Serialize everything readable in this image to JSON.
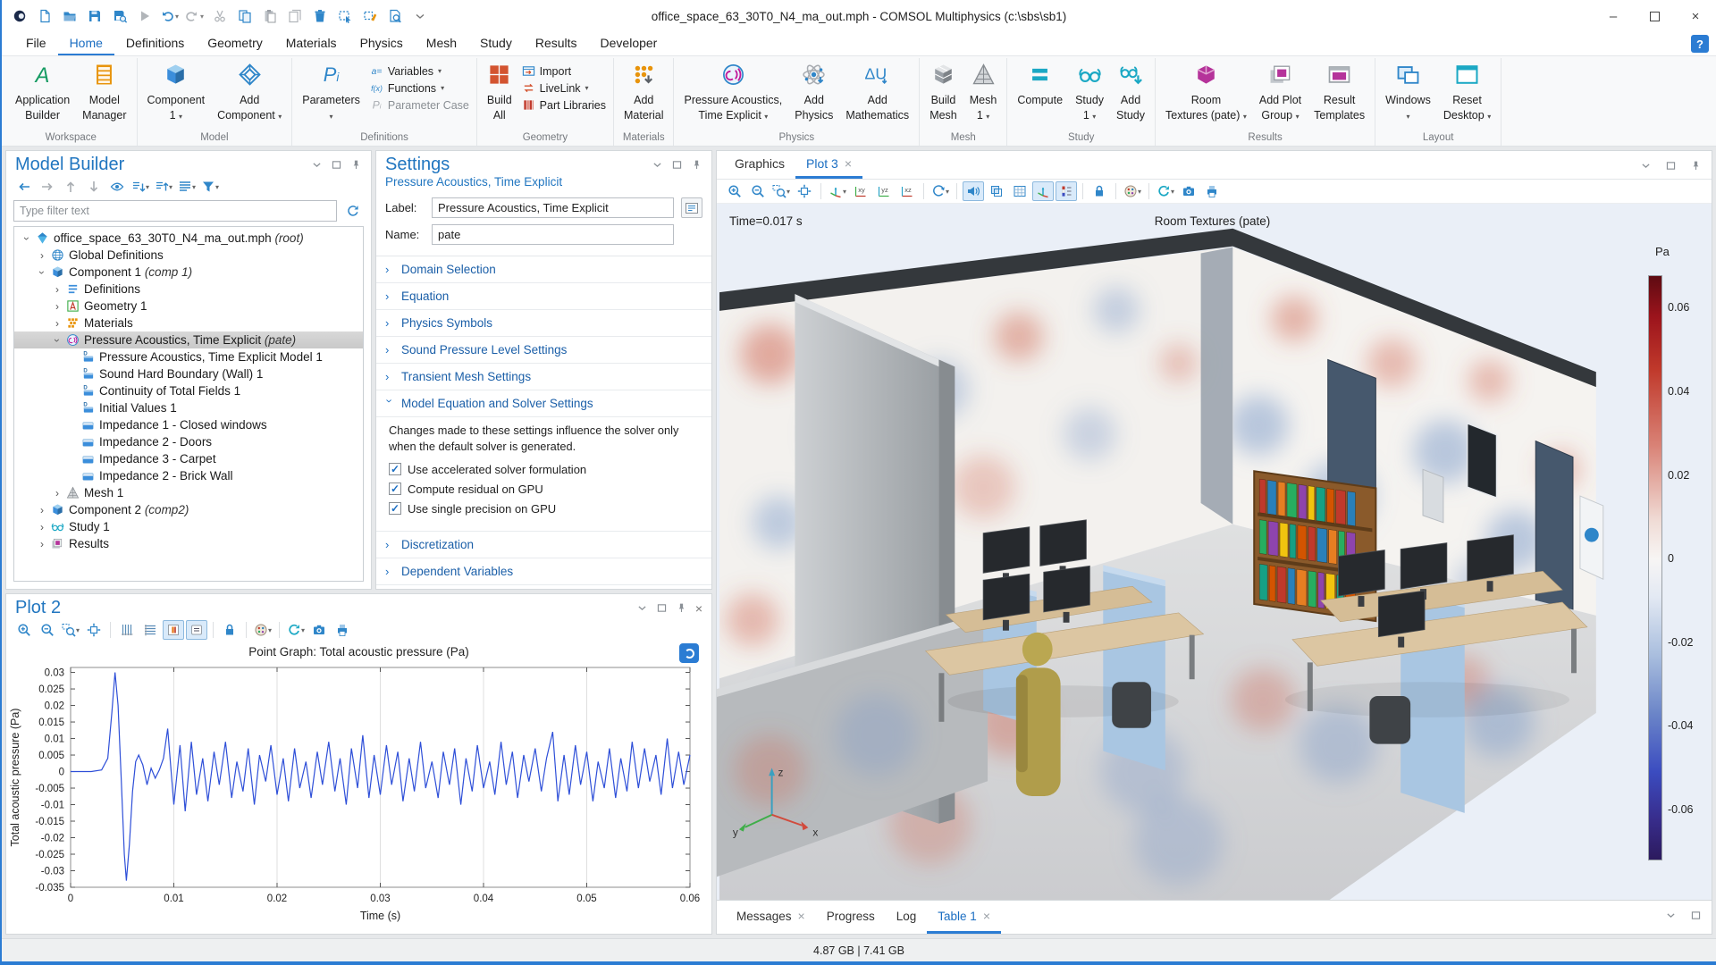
{
  "window": {
    "title": "office_space_63_30T0_N4_ma_out.mph - COMSOL Multiphysics (c:\\sbs\\sb1)",
    "controls": {
      "minimize": "–",
      "close": "×"
    }
  },
  "titlebar": {
    "quick_access": [
      {
        "name": "app-logo",
        "icon": "app-logo"
      },
      {
        "name": "new-file",
        "icon": "new-file"
      },
      {
        "name": "open",
        "icon": "open-folder"
      },
      {
        "name": "save",
        "icon": "save"
      },
      {
        "name": "save-as",
        "icon": "save-search"
      },
      {
        "name": "run",
        "icon": "play",
        "disabled": true
      },
      {
        "name": "undo",
        "icon": "undo",
        "arrow": true
      },
      {
        "name": "redo",
        "icon": "redo",
        "arrow": true,
        "disabled": true
      },
      {
        "name": "cut",
        "icon": "cut",
        "disabled": true
      },
      {
        "name": "copy",
        "icon": "copy"
      },
      {
        "name": "paste",
        "icon": "paste",
        "disabled": true
      },
      {
        "name": "duplicate",
        "icon": "duplicate",
        "disabled": true
      },
      {
        "name": "delete",
        "icon": "delete"
      },
      {
        "name": "select-region",
        "icon": "select-box"
      },
      {
        "name": "clear-selection",
        "icon": "clear-box"
      },
      {
        "name": "find",
        "icon": "find-doc"
      },
      {
        "name": "toolbar-overflow",
        "icon": "overflow"
      }
    ]
  },
  "menubar": {
    "items": [
      "File",
      "Home",
      "Definitions",
      "Geometry",
      "Materials",
      "Physics",
      "Mesh",
      "Study",
      "Results",
      "Developer"
    ],
    "active": "Home",
    "help_label": "?"
  },
  "ribbon": {
    "groups": [
      {
        "label": "Workspace",
        "buttons": [
          {
            "type": "big",
            "icon": "app-builder",
            "line1": "Application",
            "line2": "Builder"
          },
          {
            "type": "big",
            "icon": "model-manager",
            "line1": "Model",
            "line2": "Manager"
          }
        ]
      },
      {
        "label": "Model",
        "buttons": [
          {
            "type": "big",
            "icon": "component-cube",
            "line1": "Component",
            "line2": "1",
            "arrow": true
          },
          {
            "type": "big",
            "icon": "add-component",
            "line1": "Add",
            "line2": "Component",
            "arrow": true
          }
        ]
      },
      {
        "label": "Definitions",
        "buttons": [
          {
            "type": "big",
            "icon": "pi-icon",
            "line1": "Parameters",
            "line2": "",
            "arrow": true
          },
          {
            "type": "stack",
            "items": [
              {
                "icon": "variables",
                "label": "Variables",
                "arrow": true
              },
              {
                "icon": "functions",
                "label": "Functions",
                "arrow": true
              },
              {
                "icon": "param-case",
                "label": "Parameter Case",
                "disabled": true
              }
            ]
          }
        ]
      },
      {
        "label": "Geometry",
        "buttons": [
          {
            "type": "big",
            "icon": "build-all",
            "line1": "Build",
            "line2": "All"
          },
          {
            "type": "stack",
            "items": [
              {
                "icon": "import",
                "label": "Import"
              },
              {
                "icon": "livelink",
                "label": "LiveLink",
                "arrow": true
              },
              {
                "icon": "part-libraries",
                "label": "Part Libraries"
              }
            ]
          }
        ]
      },
      {
        "label": "Materials",
        "buttons": [
          {
            "type": "big",
            "icon": "add-material",
            "line1": "Add",
            "line2": "Material"
          }
        ]
      },
      {
        "label": "Physics",
        "buttons": [
          {
            "type": "big",
            "icon": "physics-acoustics",
            "line1": "Pressure Acoustics,",
            "line2": "Time Explicit",
            "arrow": true
          },
          {
            "type": "big",
            "icon": "add-physics",
            "line1": "Add",
            "line2": "Physics"
          },
          {
            "type": "big",
            "icon": "add-math",
            "line1": "Add",
            "line2": "Mathematics"
          }
        ]
      },
      {
        "label": "Mesh",
        "buttons": [
          {
            "type": "big",
            "icon": "mesh-cube",
            "line1": "Build",
            "line2": "Mesh"
          },
          {
            "type": "big",
            "icon": "mesh-tet",
            "line1": "Mesh",
            "line2": "1",
            "arrow": true
          }
        ]
      },
      {
        "label": "Study",
        "buttons": [
          {
            "type": "big",
            "icon": "compute-eq",
            "line1": "Compute",
            "line2": ""
          },
          {
            "type": "big",
            "icon": "study-glasses",
            "line1": "Study",
            "line2": "1",
            "arrow": true
          },
          {
            "type": "big",
            "icon": "add-study",
            "line1": "Add",
            "line2": "Study"
          }
        ]
      },
      {
        "label": "Results",
        "buttons": [
          {
            "type": "big",
            "icon": "room-cube",
            "line1": "Room",
            "line2": "Textures (pate)",
            "arrow": true
          },
          {
            "type": "big",
            "icon": "add-plot-group",
            "line1": "Add Plot",
            "line2": "Group",
            "arrow": true
          },
          {
            "type": "big",
            "icon": "result-templates",
            "line1": "Result",
            "line2": "Templates"
          }
        ]
      },
      {
        "label": "Layout",
        "buttons": [
          {
            "type": "big",
            "icon": "windows-icon",
            "line1": "Windows",
            "line2": "",
            "arrow": true
          },
          {
            "type": "big",
            "icon": "reset-desktop",
            "line1": "Reset",
            "line2": "Desktop",
            "arrow": true
          }
        ]
      }
    ]
  },
  "model_builder": {
    "title": "Model Builder",
    "filter_placeholder": "Type filter text",
    "toolbar": [
      {
        "name": "back"
      },
      {
        "name": "forward",
        "disabled": true
      },
      {
        "name": "move-up",
        "disabled": true
      },
      {
        "name": "move-down",
        "disabled": true
      },
      {
        "name": "show",
        "icon": "show"
      },
      {
        "name": "expand-all",
        "arrow": true
      },
      {
        "name": "collapse-all",
        "arrow": true
      },
      {
        "name": "node-view",
        "arrow": true
      },
      {
        "name": "model-filter",
        "arrow": true
      }
    ],
    "tree": [
      {
        "depth": 0,
        "expander": "v",
        "icon": "root-model",
        "label": "office_space_63_30T0_N4_ma_out.mph",
        "suffix": "(root)"
      },
      {
        "depth": 1,
        "expander": ">",
        "icon": "globe",
        "label": "Global Definitions"
      },
      {
        "depth": 1,
        "expander": "v",
        "icon": "component-cube",
        "label": "Component 1",
        "suffix": "(comp 1)"
      },
      {
        "depth": 2,
        "expander": ">",
        "icon": "definitions-list",
        "label": "Definitions"
      },
      {
        "depth": 2,
        "expander": ">",
        "icon": "geometry-a",
        "label": "Geometry 1"
      },
      {
        "depth": 2,
        "expander": ">",
        "icon": "materials-dots",
        "label": "Materials"
      },
      {
        "depth": 2,
        "expander": "v",
        "icon": "physics-acoustics",
        "label": "Pressure Acoustics, Time Explicit",
        "suffix": "(pate)",
        "selected": true
      },
      {
        "depth": 3,
        "icon": "node-d",
        "label": "Pressure Acoustics, Time Explicit Model 1"
      },
      {
        "depth": 3,
        "icon": "node-d",
        "label": "Sound Hard Boundary (Wall) 1"
      },
      {
        "depth": 3,
        "icon": "node-d",
        "label": "Continuity of Total Fields 1"
      },
      {
        "depth": 3,
        "icon": "node-d",
        "label": "Initial Values 1"
      },
      {
        "depth": 3,
        "icon": "node-plain",
        "label": "Impedance 1 - Closed windows"
      },
      {
        "depth": 3,
        "icon": "node-plain",
        "label": "Impedance 2 - Doors"
      },
      {
        "depth": 3,
        "icon": "node-plain",
        "label": "Impedance 3 - Carpet"
      },
      {
        "depth": 3,
        "icon": "node-plain",
        "label": "Impedance 2 - Brick Wall"
      },
      {
        "depth": 2,
        "expander": ">",
        "icon": "mesh-tet",
        "label": "Mesh 1"
      },
      {
        "depth": 1,
        "expander": ">",
        "icon": "component-cube",
        "label": "Component 2",
        "suffix": "(comp2)"
      },
      {
        "depth": 1,
        "expander": ">",
        "icon": "study-glasses",
        "label": "Study 1"
      },
      {
        "depth": 1,
        "expander": ">",
        "icon": "results-group",
        "label": "Results"
      }
    ]
  },
  "settings": {
    "title": "Settings",
    "subtitle": "Pressure Acoustics, Time Explicit",
    "fields": {
      "label_caption": "Label:",
      "label_value": "Pressure Acoustics, Time Explicit",
      "name_caption": "Name:",
      "name_value": "pate"
    },
    "sections": [
      {
        "label": "Domain Selection",
        "state": "collapsed"
      },
      {
        "label": "Equation",
        "state": "collapsed"
      },
      {
        "label": "Physics Symbols",
        "state": "collapsed"
      },
      {
        "label": "Sound Pressure Level Settings",
        "state": "collapsed"
      },
      {
        "label": "Transient Mesh Settings",
        "state": "collapsed"
      },
      {
        "label": "Model Equation and Solver Settings",
        "state": "expanded",
        "note": "Changes made to these settings influence the solver only when the default solver is generated.",
        "checkboxes": [
          {
            "label": "Use accelerated solver formulation",
            "checked": true
          },
          {
            "label": "Compute residual on GPU",
            "checked": true
          },
          {
            "label": "Use single precision on GPU",
            "checked": true
          }
        ]
      },
      {
        "label": "Discretization",
        "state": "collapsed"
      },
      {
        "label": "Dependent Variables",
        "state": "collapsed"
      }
    ]
  },
  "plot2": {
    "title": "Plot 2",
    "toolbar": [
      {
        "name": "zoom-in"
      },
      {
        "name": "zoom-out"
      },
      {
        "name": "zoom-box",
        "arrow": true
      },
      {
        "name": "zoom-extents"
      },
      {
        "sep": true
      },
      {
        "name": "vertical-grid"
      },
      {
        "name": "horizontal-grid"
      },
      {
        "name": "show-axes",
        "active": true
      },
      {
        "name": "show-legends",
        "active": true
      },
      {
        "sep": true
      },
      {
        "name": "lock-axes"
      },
      {
        "sep": true
      },
      {
        "name": "scene-appearance",
        "arrow": true
      },
      {
        "sep": true
      },
      {
        "name": "update-plot",
        "arrow": true
      },
      {
        "name": "snapshot"
      },
      {
        "name": "print"
      }
    ]
  },
  "chart_data": {
    "type": "line",
    "title": "Point Graph: Total acoustic pressure (Pa)",
    "xlabel": "Time (s)",
    "ylabel": "Total acoustic pressure (Pa)",
    "xlim": [
      0,
      0.06
    ],
    "ylim": [
      -0.035,
      0.0315
    ],
    "xticks": [
      0,
      0.01,
      0.02,
      0.03,
      0.04,
      0.05,
      0.06
    ],
    "yticks": [
      0.03,
      0.025,
      0.02,
      0.015,
      0.01,
      0.005,
      0,
      -0.005,
      -0.01,
      -0.015,
      -0.02,
      -0.025,
      -0.03,
      -0.035
    ],
    "grid": "vertical",
    "legend": "none",
    "line_color": "#2e4fd8",
    "series": [
      {
        "name": "Total acoustic pressure",
        "x": [
          0,
          0.001,
          0.002,
          0.003,
          0.0036,
          0.004,
          0.0043,
          0.0046,
          0.0049,
          0.0052,
          0.0054,
          0.0057,
          0.006,
          0.0063,
          0.0066,
          0.007,
          0.0074,
          0.0078,
          0.0082,
          0.0086,
          0.009,
          0.0094,
          0.01,
          0.0106,
          0.0111,
          0.0117,
          0.0122,
          0.0128,
          0.0133,
          0.0139,
          0.0144,
          0.015,
          0.0156,
          0.0161,
          0.0167,
          0.0172,
          0.0178,
          0.0183,
          0.0189,
          0.0194,
          0.02,
          0.0206,
          0.0211,
          0.0217,
          0.0222,
          0.0228,
          0.0233,
          0.0239,
          0.0244,
          0.025,
          0.0256,
          0.0261,
          0.0267,
          0.0272,
          0.0278,
          0.0283,
          0.0289,
          0.0294,
          0.03,
          0.0306,
          0.0311,
          0.0317,
          0.0322,
          0.0328,
          0.0333,
          0.0339,
          0.0344,
          0.035,
          0.0356,
          0.0361,
          0.0367,
          0.0372,
          0.0378,
          0.0383,
          0.0389,
          0.0394,
          0.04,
          0.0406,
          0.0411,
          0.0417,
          0.0422,
          0.0428,
          0.0433,
          0.0439,
          0.0444,
          0.045,
          0.0456,
          0.0461,
          0.0467,
          0.0472,
          0.0478,
          0.0483,
          0.0489,
          0.0494,
          0.05,
          0.0506,
          0.0511,
          0.0517,
          0.0522,
          0.0528,
          0.0533,
          0.0539,
          0.0544,
          0.055,
          0.0556,
          0.0561,
          0.0567,
          0.0572,
          0.0578,
          0.0583,
          0.0589,
          0.0594,
          0.06
        ],
        "y": [
          0,
          0,
          0,
          0.0005,
          0.004,
          0.018,
          0.03,
          0.02,
          -0.002,
          -0.025,
          -0.033,
          -0.022,
          -0.006,
          0.003,
          0.005,
          0.002,
          -0.004,
          0.001,
          -0.002,
          0.0005,
          0.004,
          0.013,
          -0.01,
          0.008,
          -0.012,
          0.009,
          -0.007,
          0.004,
          -0.009,
          0.006,
          -0.004,
          0.009,
          -0.008,
          0.003,
          -0.006,
          0.007,
          -0.01,
          0.005,
          -0.003,
          0.008,
          -0.007,
          0.004,
          -0.009,
          0.007,
          -0.005,
          0.003,
          -0.008,
          0.006,
          -0.004,
          0.009,
          -0.006,
          0.004,
          -0.01,
          0.007,
          -0.005,
          0.011,
          -0.008,
          0.005,
          -0.007,
          0.008,
          -0.004,
          0.006,
          -0.009,
          0.004,
          -0.006,
          0.009,
          -0.005,
          0.003,
          -0.008,
          0.006,
          -0.004,
          0.007,
          -0.01,
          0.004,
          -0.006,
          0.008,
          -0.005,
          0.003,
          -0.007,
          0.009,
          -0.004,
          0.006,
          -0.008,
          0.005,
          -0.003,
          0.007,
          -0.006,
          0.004,
          0.012,
          -0.009,
          0.005,
          -0.007,
          0.008,
          -0.004,
          0.006,
          -0.009,
          0.003,
          -0.005,
          0.007,
          -0.008,
          0.004,
          -0.006,
          0.009,
          -0.005,
          0.007,
          -0.003,
          0.005,
          -0.007,
          0.01,
          -0.005,
          0.006,
          -0.004,
          0.005
        ]
      }
    ]
  },
  "graphics": {
    "tabs": [
      {
        "label": "Graphics"
      },
      {
        "label": "Plot 3",
        "active": true,
        "closable": true
      }
    ],
    "toolbar": [
      {
        "name": "zoom-in"
      },
      {
        "name": "zoom-out"
      },
      {
        "name": "zoom-box",
        "arrow": true
      },
      {
        "name": "zoom-extents"
      },
      {
        "sep": true
      },
      {
        "name": "go-to-view",
        "arrow": true
      },
      {
        "name": "view-xy"
      },
      {
        "name": "view-yz"
      },
      {
        "name": "view-xz"
      },
      {
        "sep": true
      },
      {
        "name": "rotate-view",
        "arrow": true
      },
      {
        "sep": true
      },
      {
        "name": "sound",
        "active": true
      },
      {
        "name": "transparency"
      },
      {
        "name": "show-grid"
      },
      {
        "name": "scene-axes",
        "active": true
      },
      {
        "name": "color-legend",
        "active": true
      },
      {
        "sep": true
      },
      {
        "name": "lock-axes"
      },
      {
        "sep": true
      },
      {
        "name": "scene-appearance",
        "arrow": true
      },
      {
        "sep": true
      },
      {
        "name": "update-plot",
        "arrow": true
      },
      {
        "name": "snapshot"
      },
      {
        "name": "print"
      }
    ],
    "time_label": "Time=0.017 s",
    "plot_title": "Room Textures (pate)",
    "colorbar": {
      "unit": "Pa",
      "ticks": [
        "0.06",
        "0.04",
        "0.02",
        "0",
        "-0.02",
        "-0.04",
        "-0.06"
      ]
    },
    "triad": {
      "x": "x",
      "y": "y",
      "z": "z"
    }
  },
  "bottom_tabs": [
    {
      "label": "Messages",
      "closable": true
    },
    {
      "label": "Progress"
    },
    {
      "label": "Log"
    },
    {
      "label": "Table 1",
      "closable": true,
      "active": true
    }
  ],
  "statusbar": {
    "memory": "4.87 GB | 7.41 GB"
  }
}
